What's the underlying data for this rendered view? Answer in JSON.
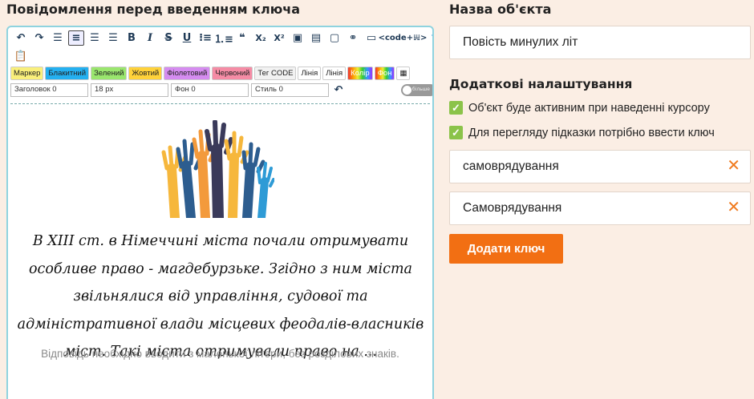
{
  "editor": {
    "title": "Повідомлення перед введенням ключа",
    "toolbar": {
      "code_label": "<code+𝍏>",
      "chips": [
        {
          "label": "Маркер",
          "bg": "#f9ef7b"
        },
        {
          "label": "Блакитний",
          "bg": "#24b0f0"
        },
        {
          "label": "Зелений",
          "bg": "#9ae66e"
        },
        {
          "label": "Жовтий",
          "bg": "#ffd23a"
        },
        {
          "label": "Фіолетовий",
          "bg": "#d58cf0"
        },
        {
          "label": "Червоний",
          "bg": "#f58ca5"
        },
        {
          "label": "Тег CODE",
          "bg": "#f2f2f2"
        },
        {
          "label": "Лінія",
          "bg": "#ffffff"
        },
        {
          "label": "Лінія",
          "bg": "#ffffff"
        },
        {
          "label": "Колір",
          "bg": "rainbow"
        },
        {
          "label": "Фон",
          "bg": "rainbow"
        }
      ],
      "heading_select": "Заголовок 0",
      "size_select": "18 px",
      "bg_select": "Фон 0",
      "style_select": "Стиль 0",
      "toggle_label": "більше"
    },
    "body_text": "В XIII ст. в Німеччині міста почали отримувати особливе право - магдебурзьке. Згідно з ним міста звільнялися від управління, судової та адміністративної влади місцевих феодалів-власників міст. Такі міста отримували право на ...",
    "hint": "Відповідь необхідно вводити з маленької літери, без розділових знаків."
  },
  "right": {
    "object_name_label": "Назва об'єкта",
    "object_name_value": "Повість минулих літ",
    "extra_settings_label": "Додаткові налаштування",
    "check1": "Об'єкт буде активним при наведенні курсору",
    "check2": "Для перегляду підказки потрібно ввести ключ",
    "key1": "самоврядування",
    "key2": "Самоврядування",
    "add_key_button": "Додати ключ"
  },
  "colors": {
    "accent": "#f26f13",
    "check": "#8bc34a",
    "editor_border": "#8fd3df"
  }
}
